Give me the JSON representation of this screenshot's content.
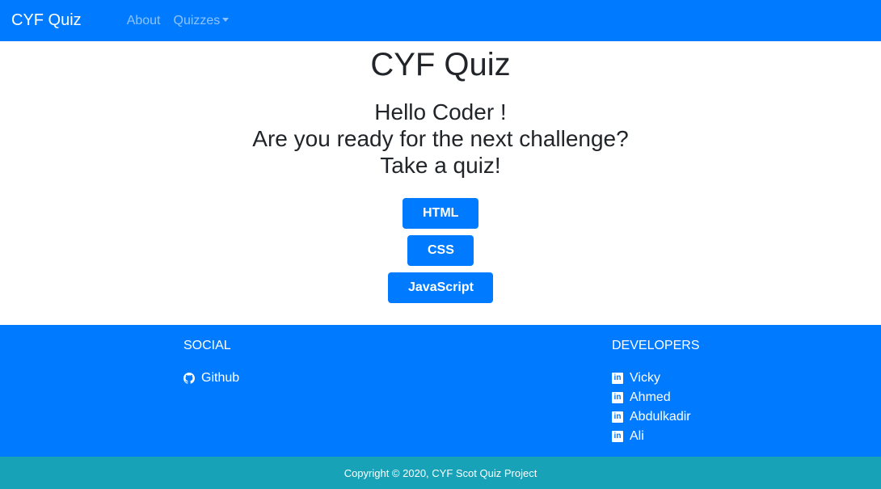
{
  "navbar": {
    "brand": "CYF Quiz",
    "links": [
      "About",
      "Quizzes"
    ]
  },
  "main": {
    "title": "CYF Quiz",
    "greeting": [
      "Hello Coder !",
      "Are you ready for the next challenge?",
      "Take a quiz!"
    ],
    "buttons": [
      "HTML",
      "CSS",
      "JavaScript"
    ]
  },
  "footer": {
    "social": {
      "heading": "SOCIAL",
      "items": [
        {
          "label": "Github",
          "icon": "github-icon"
        }
      ]
    },
    "developers": {
      "heading": "DEVELOPERS",
      "items": [
        "Vicky",
        "Ahmed",
        "Abdulkadir",
        "Ali"
      ],
      "icon": "linkedin-icon"
    }
  },
  "copyright": "Copyright © 2020, CYF Scot Quiz Project"
}
